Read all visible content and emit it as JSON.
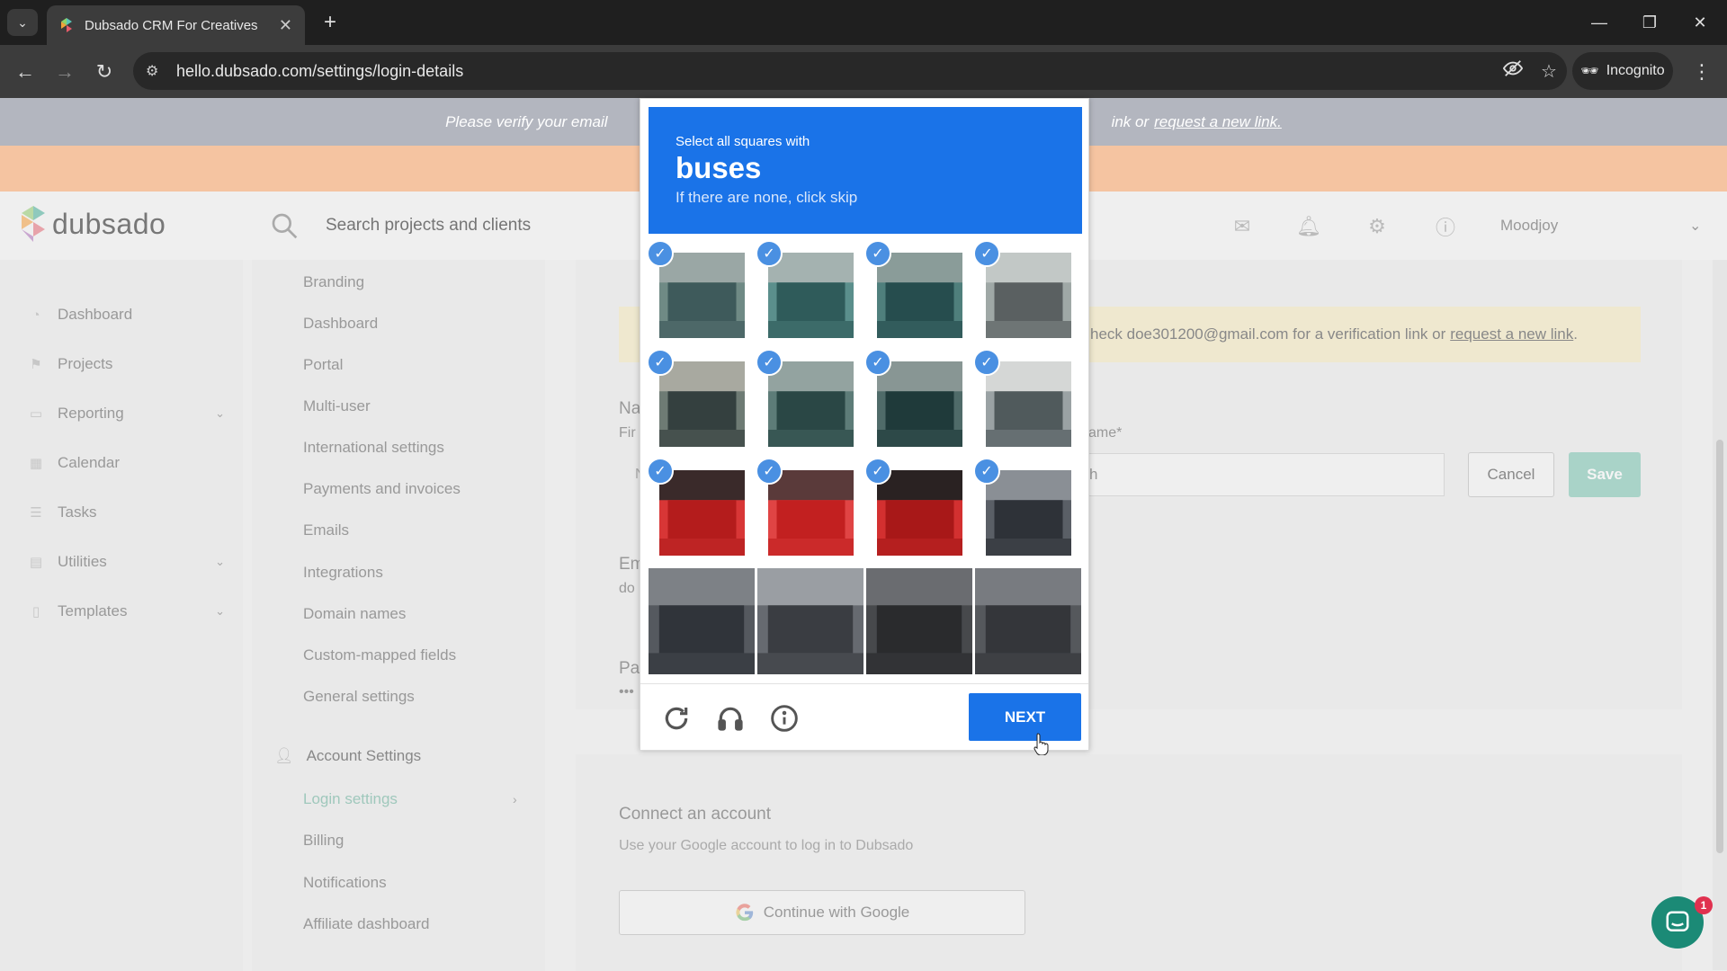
{
  "browser": {
    "tab_title": "Dubsado CRM For Creatives",
    "url": "hello.dubsado.com/settings/login-details",
    "incognito_label": "Incognito"
  },
  "banner": {
    "text": "Please verify your email",
    "link_prefix": "ink or",
    "link": "request a new link."
  },
  "header": {
    "logo_text": "dubsado",
    "search_placeholder": "Search projects and clients",
    "user_name": "Moodjoy"
  },
  "side_nav": {
    "items": [
      {
        "label": "Dashboard",
        "icon": "dashboard-icon",
        "expandable": false
      },
      {
        "label": "Projects",
        "icon": "projects-icon",
        "expandable": false
      },
      {
        "label": "Reporting",
        "icon": "reporting-icon",
        "expandable": true
      },
      {
        "label": "Calendar",
        "icon": "calendar-icon",
        "expandable": false
      },
      {
        "label": "Tasks",
        "icon": "tasks-icon",
        "expandable": false
      },
      {
        "label": "Utilities",
        "icon": "utilities-icon",
        "expandable": true
      },
      {
        "label": "Templates",
        "icon": "templates-icon",
        "expandable": true
      }
    ]
  },
  "settings_nav": {
    "items": [
      "Branding",
      "Dashboard",
      "Portal",
      "Multi-user",
      "International settings",
      "Payments and invoices",
      "Emails",
      "Integrations",
      "Domain names",
      "Custom-mapped fields",
      "General settings"
    ],
    "account_section": "Account Settings",
    "account_items": [
      "Login settings",
      "Billing",
      "Notifications",
      "Affiliate dashboard"
    ],
    "active": "Login settings"
  },
  "main": {
    "warning_text": "heck doe301200@gmail.com for a verification link or",
    "warning_link": "request a new link",
    "warning_end": ".",
    "name_frag": "Na",
    "first_frag": "Fir",
    "input_frag": "N",
    "last_label_frag": "ame*",
    "last_value_frag": "h",
    "email_frag": "Em",
    "email_value_frag": "do",
    "password_frag": "Pa",
    "password_value_frag": "•••",
    "cancel_label": "Cancel",
    "save_label": "Save",
    "connect_title": "Connect an account",
    "connect_sub": "Use your Google account to log in to Dubsado",
    "google_button": "Continue with Google"
  },
  "chat": {
    "badge": "1"
  },
  "captcha": {
    "instruction": "Select all squares with",
    "object": "buses",
    "skip_hint": "If there are none, click skip",
    "next_label": "NEXT",
    "tiles_selected": [
      true,
      true,
      true,
      true,
      true,
      true,
      true,
      true,
      true,
      true,
      true,
      true,
      false,
      false,
      false,
      false
    ]
  },
  "colors": {
    "captcha_blue": "#1a73e8",
    "brand_teal": "#1b8a76",
    "active_link": "#9fc8bc"
  }
}
